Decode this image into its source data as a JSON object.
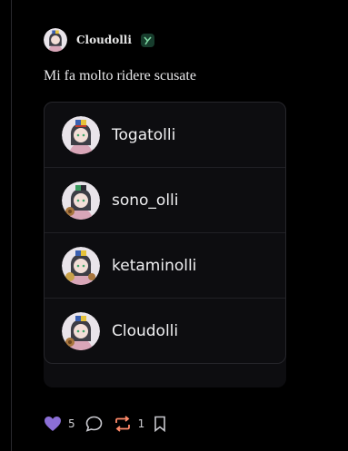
{
  "post": {
    "author": "Cloudolli",
    "text": "Mi fa molto ridere scusate",
    "badge_icon": "leaf-badge-icon"
  },
  "embed": {
    "users": [
      {
        "name": "Togatolli"
      },
      {
        "name": "sono_olli"
      },
      {
        "name": "ketaminolli"
      },
      {
        "name": "Cloudolli"
      }
    ]
  },
  "actions": {
    "like_count": "5",
    "repost_count": "1"
  },
  "colors": {
    "background": "#000000",
    "like": "#8b6fd6",
    "repost": "#ff8a6a",
    "badge": "#173d2d"
  }
}
